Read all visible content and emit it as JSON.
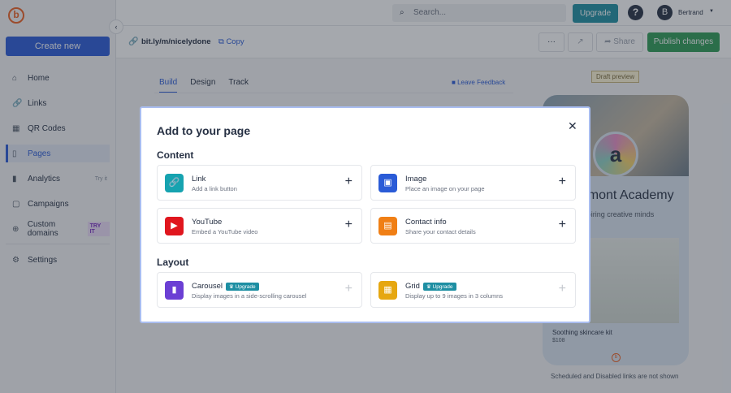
{
  "sidebar": {
    "create_new": "Create new",
    "items": [
      {
        "label": "Home",
        "icon": "⌂"
      },
      {
        "label": "Links",
        "icon": "🔗"
      },
      {
        "label": "QR Codes",
        "icon": "▦"
      },
      {
        "label": "Pages",
        "icon": "▯"
      },
      {
        "label": "Analytics",
        "icon": "▮",
        "tag": "Try it"
      },
      {
        "label": "Campaigns",
        "icon": "▢"
      },
      {
        "label": "Custom domains",
        "icon": "⊕",
        "tag": "TRY IT"
      },
      {
        "label": "Settings",
        "icon": "⚙"
      }
    ]
  },
  "topbar": {
    "search_placeholder": "Search...",
    "upgrade": "Upgrade",
    "help": "?",
    "avatar_initial": "B",
    "user": "Bertrand"
  },
  "subbar": {
    "url": "bit.ly/m/nicelydone",
    "copy": "Copy",
    "more": "···",
    "share": "Share",
    "publish": "Publish changes"
  },
  "tabs": [
    "Build",
    "Design",
    "Track"
  ],
  "leave_feedback": "Leave Feedback",
  "preview": {
    "badge": "Draft preview",
    "title": "Beaumont Academy",
    "subtitle": "Inspiring creative minds",
    "product_name": "Soothing skincare kit",
    "product_price": "$108",
    "note": "Scheduled and Disabled links are not shown"
  },
  "modal": {
    "title": "Add to your page",
    "content_heading": "Content",
    "layout_heading": "Layout",
    "upgrade_badge": "Upgrade",
    "content": [
      {
        "title": "Link",
        "desc": "Add a link button",
        "color": "#16a3b0",
        "icon": "🔗"
      },
      {
        "title": "Image",
        "desc": "Place an image on your page",
        "color": "#2a5bd7",
        "icon": "▣"
      },
      {
        "title": "YouTube",
        "desc": "Embed a YouTube video",
        "color": "#e0161e",
        "icon": "▶"
      },
      {
        "title": "Contact info",
        "desc": "Share your contact details",
        "color": "#f07f15",
        "icon": "▤"
      }
    ],
    "layout": [
      {
        "title": "Carousel",
        "desc": "Display images in a side-scrolling carousel",
        "color": "#6b3fd4",
        "icon": "▮"
      },
      {
        "title": "Grid",
        "desc": "Display up to 9 images in 3 columns",
        "color": "#e6a710",
        "icon": "▦"
      }
    ]
  }
}
